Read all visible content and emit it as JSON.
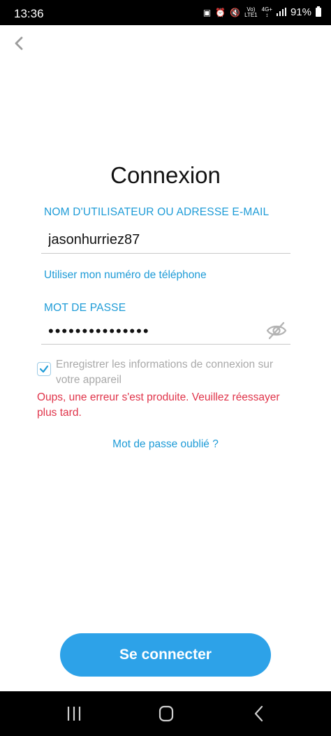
{
  "status_bar": {
    "time": "13:36",
    "volte_top": "Vo)",
    "volte_bottom": "LTE1",
    "network_top": "4G+",
    "battery_percent": "91%"
  },
  "login": {
    "title": "Connexion",
    "username_label": "NOM D'UTILISATEUR OU ADRESSE E-MAIL",
    "username_value": "jasonhurriez87",
    "use_phone_link": "Utiliser mon numéro de téléphone",
    "password_label": "MOT DE PASSE",
    "password_value": "•••••••••••••••",
    "save_info_label": "Enregistrer les informations de connexion sur votre appareil",
    "save_info_checked": true,
    "error_message": "Oups, une erreur s'est produite. Veuillez réessayer plus tard.",
    "forgot_password_link": "Mot de passe oublié ?",
    "submit_button": "Se connecter"
  },
  "colors": {
    "accent": "#1d9bd7",
    "button": "#2da2e8",
    "error": "#e0344a",
    "muted_text": "#a9a9a9"
  },
  "icons": {
    "back": "chevron-left-icon",
    "password_visibility": "eye-off-icon",
    "checkbox": "checkmark-icon",
    "nav_recents": "recents-icon",
    "nav_home": "home-icon",
    "nav_back": "back-icon"
  }
}
